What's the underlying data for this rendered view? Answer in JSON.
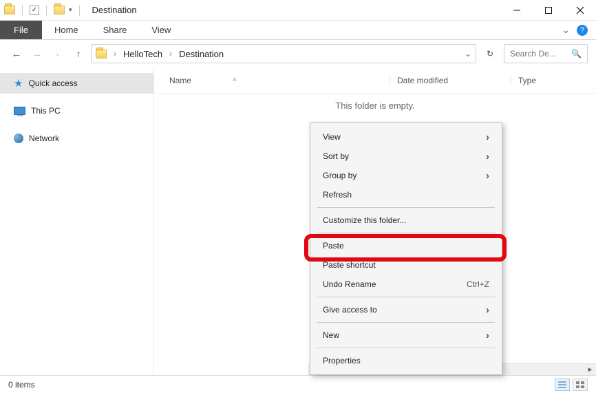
{
  "window": {
    "title": "Destination"
  },
  "ribbon": {
    "file": "File",
    "tabs": [
      "Home",
      "Share",
      "View"
    ]
  },
  "breadcrumb": {
    "parts": [
      "HelloTech",
      "Destination"
    ]
  },
  "search": {
    "placeholder": "Search De..."
  },
  "sidebar": {
    "items": [
      {
        "label": "Quick access"
      },
      {
        "label": "This PC"
      },
      {
        "label": "Network"
      }
    ]
  },
  "columns": {
    "name": "Name",
    "date": "Date modified",
    "type": "Type"
  },
  "empty_text": "This folder is empty.",
  "context_menu": {
    "view": "View",
    "sort_by": "Sort by",
    "group_by": "Group by",
    "refresh": "Refresh",
    "customize": "Customize this folder...",
    "paste": "Paste",
    "paste_shortcut": "Paste shortcut",
    "undo": "Undo Rename",
    "undo_key": "Ctrl+Z",
    "give_access": "Give access to",
    "new": "New",
    "properties": "Properties"
  },
  "status": {
    "items": "0 items"
  }
}
